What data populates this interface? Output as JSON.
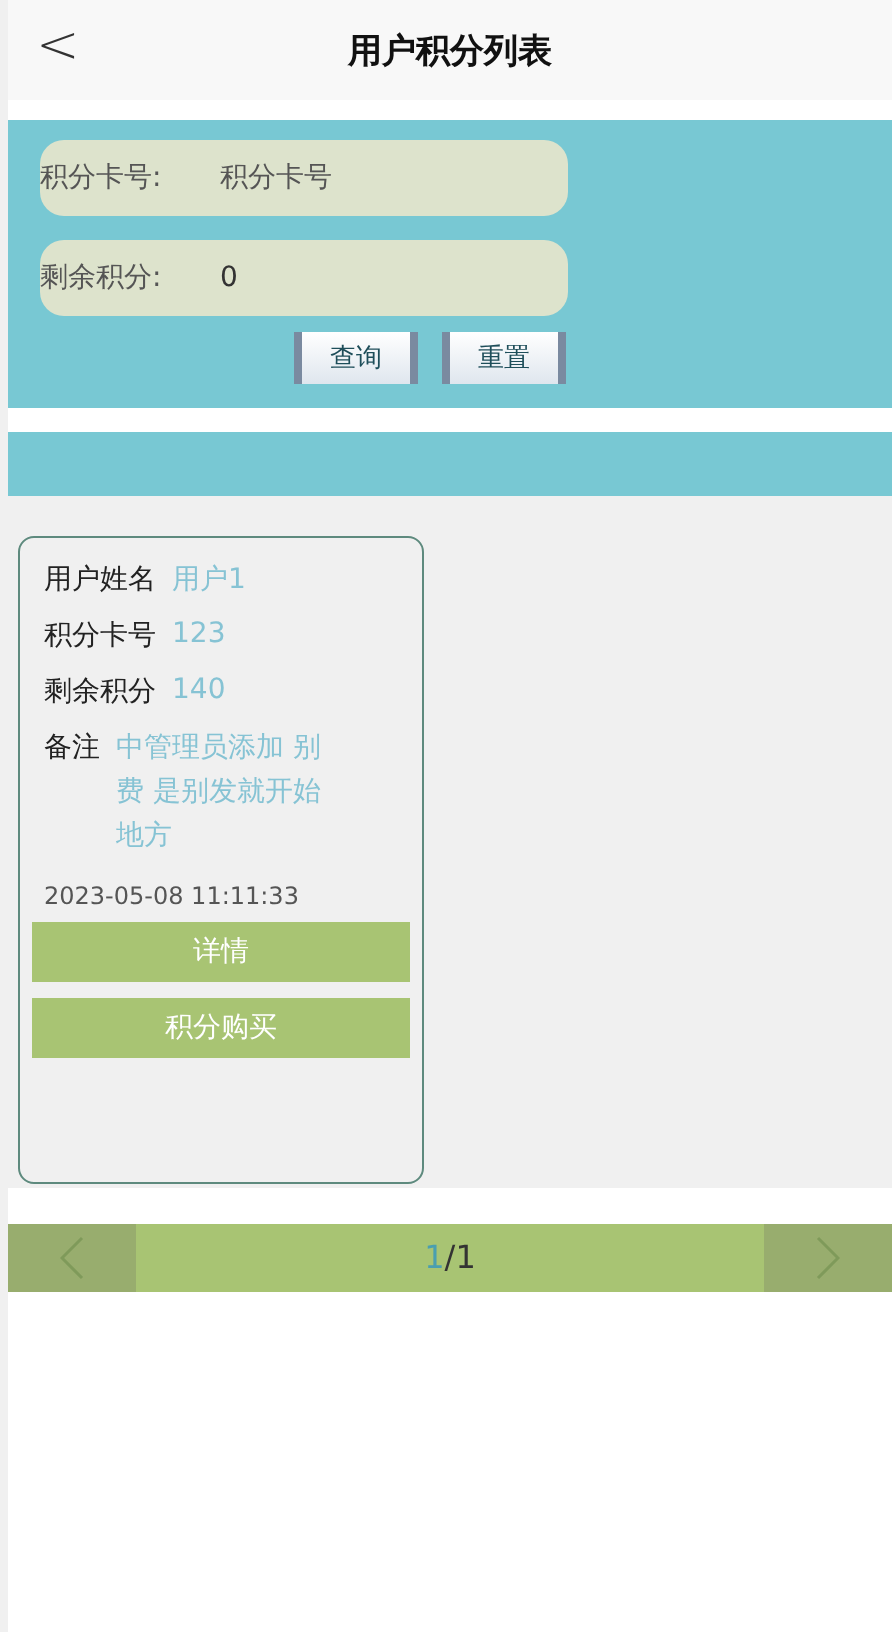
{
  "header": {
    "back_icon": "<",
    "title": "用户积分列表"
  },
  "search": {
    "fields": [
      {
        "label": "积分卡号:",
        "placeholder": "积分卡号"
      },
      {
        "label": "剩余积分:",
        "value": "0"
      }
    ],
    "buttons": [
      "查询",
      "重置"
    ]
  },
  "cards": [
    {
      "rows": [
        {
          "label": "用户姓名",
          "value": "用户1"
        },
        {
          "label": "积分卡号",
          "value": "123"
        },
        {
          "label": "剩余积分",
          "value": "140"
        }
      ],
      "remark_label": "备注",
      "remark_lines": [
        "中管理员添加 别",
        "费 是别发就开始",
        "地方"
      ],
      "time": "2023-05-08 11:11:33",
      "buttons": [
        "详情",
        "积分购买"
      ]
    }
  ],
  "pagination": {
    "current": "1",
    "total": "/1"
  }
}
